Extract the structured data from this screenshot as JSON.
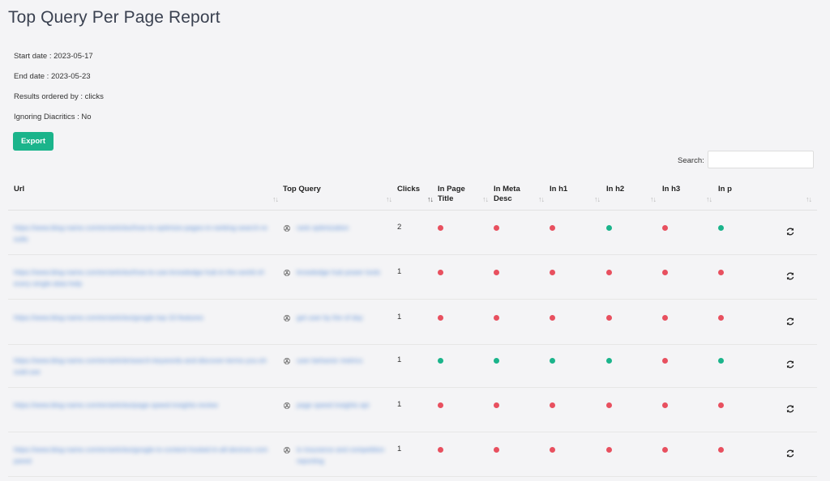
{
  "title": "Top Query Per Page Report",
  "meta": {
    "start_date": "Start date : 2023-05-17",
    "end_date": "End date : 2023-05-23",
    "ordered_by": "Results ordered by : clicks",
    "ignoring_diacritics": "Ignoring Diacritics : No"
  },
  "export_label": "Export",
  "search": {
    "label": "Search:",
    "value": ""
  },
  "columns": {
    "url": "Url",
    "top_query": "Top Query",
    "clicks": "Clicks",
    "in_page_title_1": "In Page",
    "in_page_title_2": "Title",
    "in_meta_desc_1": "In Meta",
    "in_meta_desc_2": "Desc",
    "in_h1": "In h1",
    "in_h2": "In h2",
    "in_h3": "In h3",
    "in_p": "In p"
  },
  "sort_glyph": "↑↓",
  "colors": {
    "present": "#1bb48b",
    "absent": "#e8505f",
    "accent": "#1bb48b",
    "link": "#5c8fd6"
  },
  "rows": [
    {
      "url": "https://www.blog-name.com/en/articles/how-to-optimize-pages-in-ranking-search-results",
      "query": "rank optimization",
      "clicks": "2",
      "flags": {
        "page_title": false,
        "meta_desc": false,
        "h1": false,
        "h2": true,
        "h3": false,
        "p": true
      }
    },
    {
      "url": "https://www.blog-name.com/en/articles/how-to-use-knowledge-hub-in-the-world-of-every-single-data-help",
      "query": "knowledge hub power tools",
      "clicks": "1",
      "flags": {
        "page_title": false,
        "meta_desc": false,
        "h1": false,
        "h2": false,
        "h3": false,
        "p": false
      }
    },
    {
      "url": "https://www.blog-name.com/en/articles/google-top-10-features",
      "query": "get user by the of day",
      "clicks": "1",
      "flags": {
        "page_title": false,
        "meta_desc": false,
        "h1": false,
        "h2": false,
        "h3": false,
        "p": false
      }
    },
    {
      "url": "https://www.blog-name.com/en/article/search-keywords-and-discover-terms-you-should-use",
      "query": "user behavior metrics",
      "clicks": "1",
      "flags": {
        "page_title": true,
        "meta_desc": true,
        "h1": true,
        "h2": true,
        "h3": false,
        "p": true
      }
    },
    {
      "url": "https://www.blog-name.com/en/articles/page-speed-insights-review",
      "query": "page speed insights api",
      "clicks": "1",
      "flags": {
        "page_title": false,
        "meta_desc": false,
        "h1": false,
        "h2": false,
        "h3": false,
        "p": false
      }
    },
    {
      "url": "https://www.blog-name.com/en/articles/google-tv-content-hosted-in-all-devices-compared",
      "query": "tv insurance and competition reporting",
      "clicks": "1",
      "flags": {
        "page_title": false,
        "meta_desc": false,
        "h1": false,
        "h2": false,
        "h3": false,
        "p": false
      }
    }
  ]
}
